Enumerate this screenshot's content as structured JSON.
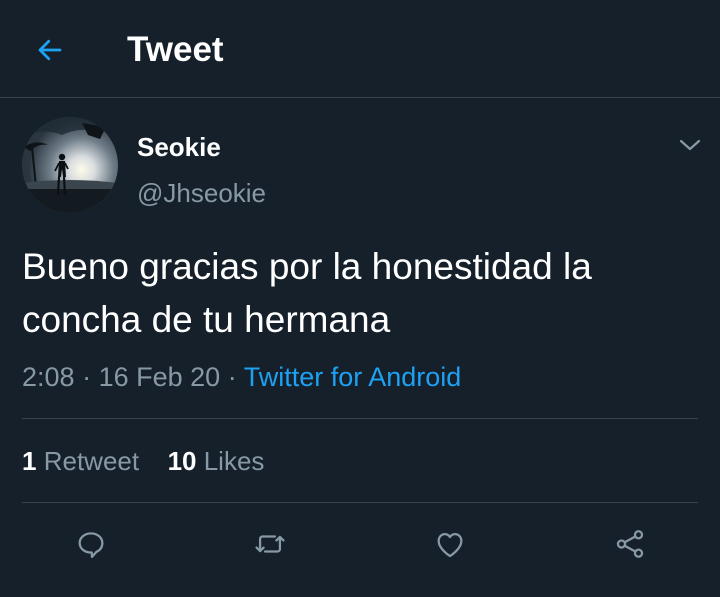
{
  "header": {
    "back_icon": "arrow-left-icon",
    "title": "Tweet"
  },
  "author": {
    "display_name": "Seokie",
    "handle": "@Jhseokie",
    "avatar_icon": "avatar-image",
    "caret_icon": "chevron-down-icon"
  },
  "tweet": {
    "text": "Bueno gracias por la honestidad la concha de tu hermana",
    "time": "2:08",
    "separator": "·",
    "date": "16 Feb 20",
    "source": "Twitter for Android"
  },
  "stats": {
    "retweets_count": "1",
    "retweets_label": "Retweet",
    "likes_count": "10",
    "likes_label": "Likes"
  },
  "actions": [
    {
      "icon": "reply-icon"
    },
    {
      "icon": "retweet-icon"
    },
    {
      "icon": "like-icon"
    },
    {
      "icon": "share-icon"
    }
  ],
  "colors": {
    "background": "#15202b",
    "divider": "#38444d",
    "accent": "#1da1f2",
    "secondary_text": "#8899a6",
    "primary_text": "#ffffff"
  }
}
